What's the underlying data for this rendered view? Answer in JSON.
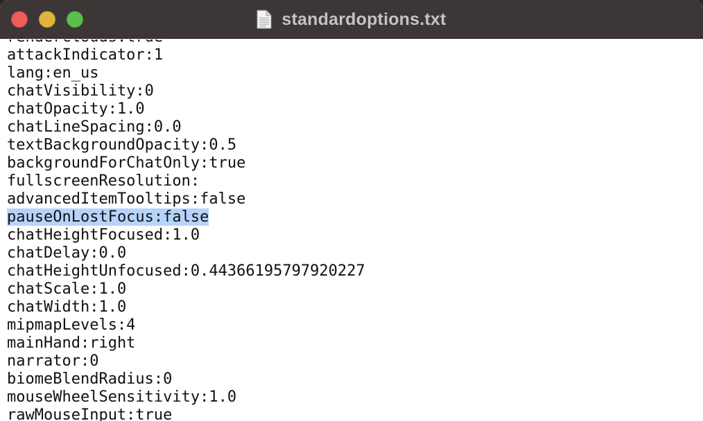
{
  "window": {
    "title": "standardoptions.txt",
    "colors": {
      "titlebar": "#3c3636",
      "close": "#ec5f58",
      "minimize": "#e1b441",
      "zoom": "#5fbd4f",
      "selection": "#b6d4fb"
    }
  },
  "editor": {
    "selected_line_index": 10,
    "lines": [
      "renderClouds:true",
      "attackIndicator:1",
      "lang:en_us",
      "chatVisibility:0",
      "chatOpacity:1.0",
      "chatLineSpacing:0.0",
      "textBackgroundOpacity:0.5",
      "backgroundForChatOnly:true",
      "fullscreenResolution:",
      "advancedItemTooltips:false",
      "pauseOnLostFocus:false",
      "chatHeightFocused:1.0",
      "chatDelay:0.0",
      "chatHeightUnfocused:0.44366195797920227",
      "chatScale:1.0",
      "chatWidth:1.0",
      "mipmapLevels:4",
      "mainHand:right",
      "narrator:0",
      "biomeBlendRadius:0",
      "mouseWheelSensitivity:1.0",
      "rawMouseInput:true"
    ]
  }
}
